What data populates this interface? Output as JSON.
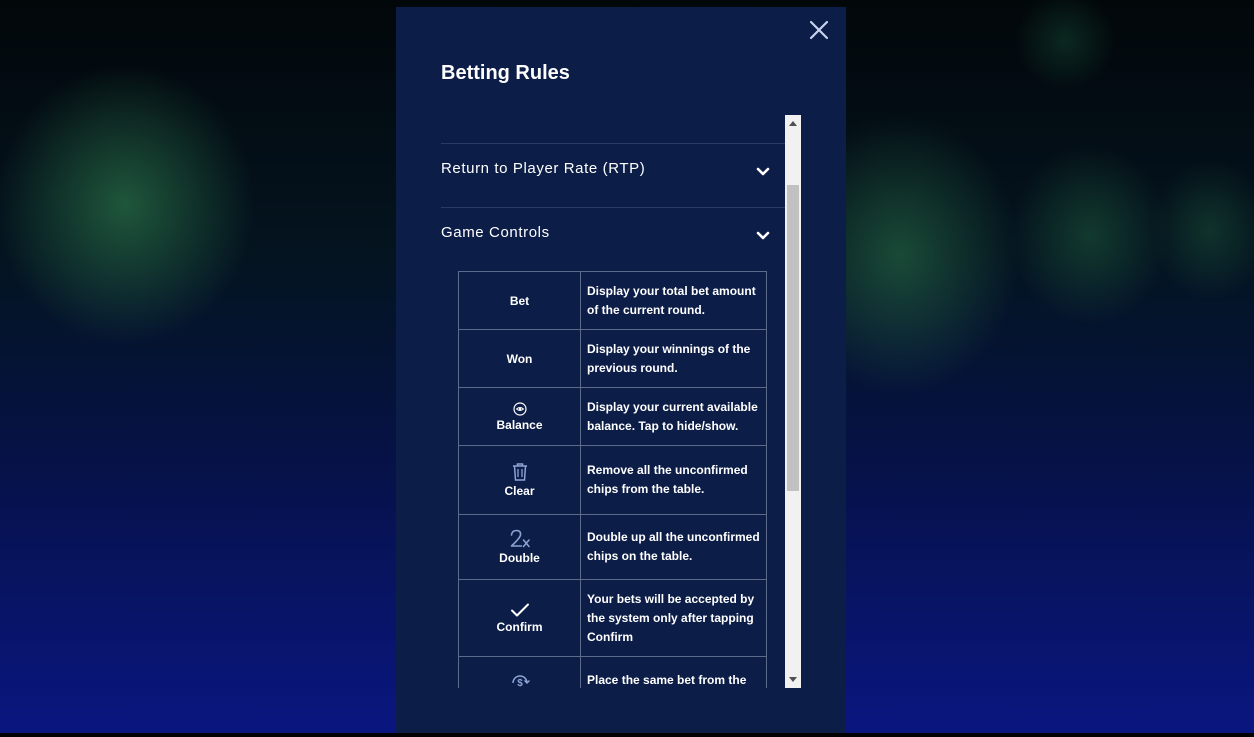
{
  "modal": {
    "title": "Betting Rules",
    "close_icon": "close-icon"
  },
  "sections": [
    {
      "label": "Return to Player Rate (RTP)",
      "icon": "chevron-down-icon"
    },
    {
      "label": "Game Controls",
      "icon": "chevron-down-icon"
    }
  ],
  "controls": [
    {
      "name": "Bet",
      "icon": "",
      "description": "Display your total bet amount of the current round."
    },
    {
      "name": "Won",
      "icon": "",
      "description": "Display your winnings of the previous round."
    },
    {
      "name": "Balance",
      "icon": "eye-icon",
      "description": "Display your current available balance. Tap to hide/show."
    },
    {
      "name": "Clear",
      "icon": "trash-icon",
      "description": "Remove all the unconfirmed chips from the table."
    },
    {
      "name": "Double",
      "icon": "double-2x-icon",
      "description": "Double up all the unconfirmed chips on the table."
    },
    {
      "name": "Confirm",
      "icon": "checkmark-icon",
      "description": "Your bets will be accepted by the system only after tapping Confirm"
    },
    {
      "name": "",
      "icon": "rebet-dollar-icon",
      "description": "Place the same bet from the"
    }
  ],
  "colors": {
    "modal_bg": "#0c1d47",
    "divider": "#2a3a63",
    "table_border": "#5d6b8b",
    "text": "#ffffff"
  }
}
